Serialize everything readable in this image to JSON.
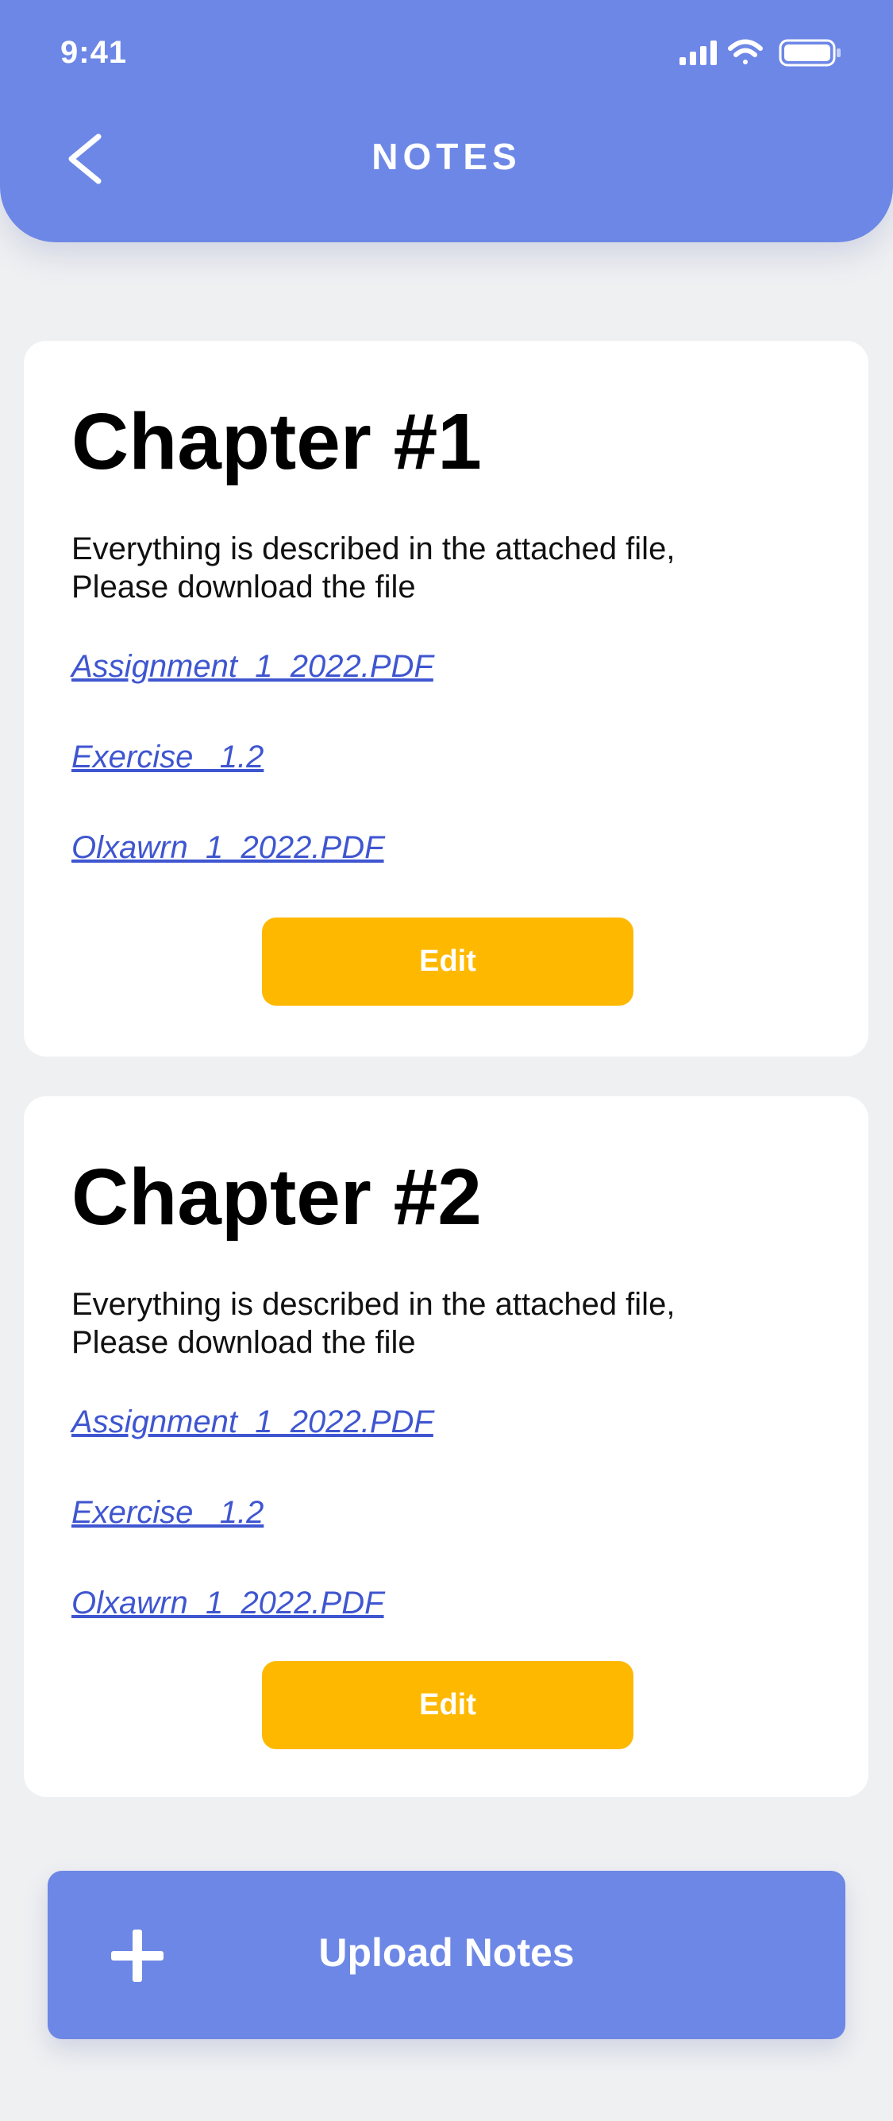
{
  "status_bar": {
    "time": "9:41",
    "icons": [
      "signal-icon",
      "wifi-icon",
      "battery-icon"
    ]
  },
  "header": {
    "title": "NOTES",
    "back_icon": "chevron-left-icon"
  },
  "chapters": [
    {
      "title": "Chapter #1",
      "description_line1": "Everything is described in the attached file,",
      "description_line2": "Please download the file",
      "files": [
        "Assignment_1_2022.PDF",
        "Exercise _1.2",
        "Olxawrn_1_2022.PDF"
      ],
      "edit_label": "Edit"
    },
    {
      "title": "Chapter #2",
      "description_line1": "Everything is described in the attached file,",
      "description_line2": "Please download the file",
      "files": [
        "Assignment_1_2022.PDF",
        "Exercise _1.2",
        "Olxawrn_1_2022.PDF"
      ],
      "edit_label": "Edit"
    }
  ],
  "upload": {
    "label": "Upload Notes",
    "icon": "plus-icon"
  },
  "colors": {
    "primary": "#6d87e6",
    "accent": "#feb800",
    "link": "#3f56d0",
    "background": "#eff0f2"
  }
}
